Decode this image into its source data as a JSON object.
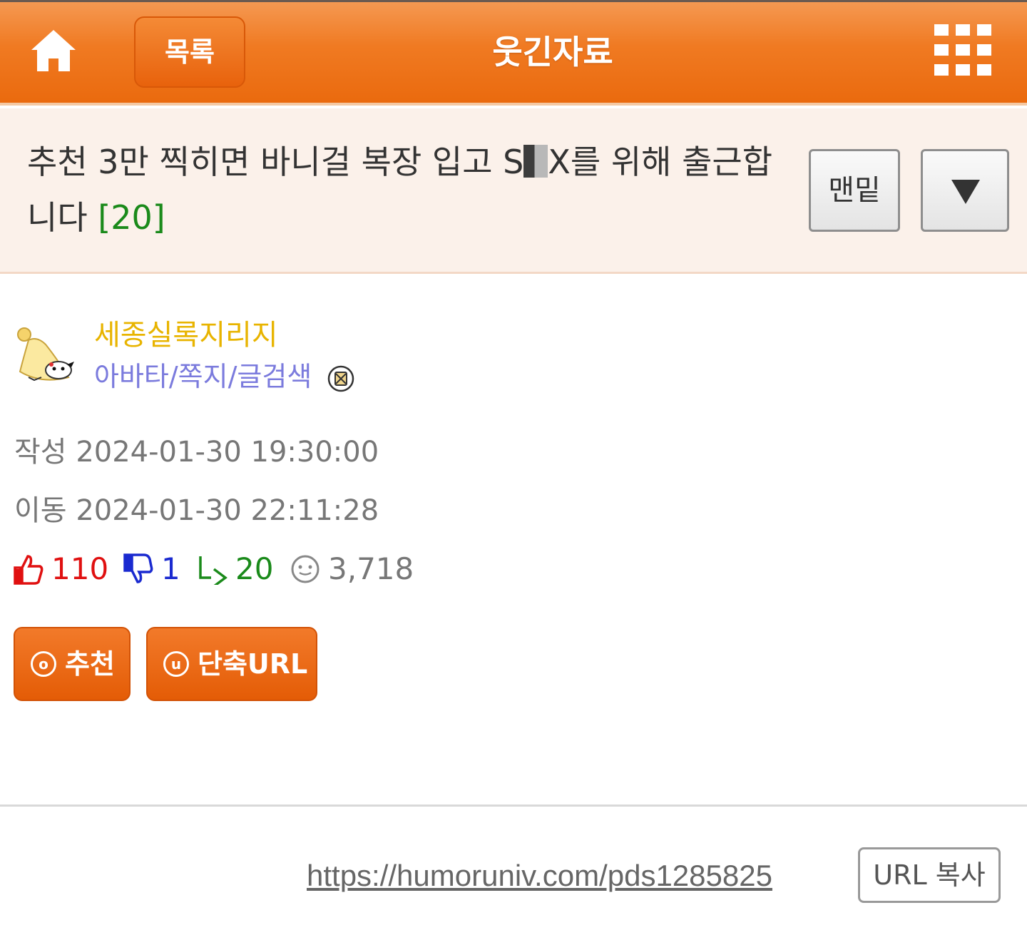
{
  "header": {
    "home_icon": "home-icon",
    "list_label": "목록",
    "board_title": "웃긴자료",
    "menu_icon": "grid-menu-icon"
  },
  "post": {
    "title_part1": "추천 3만 찍히면 바니걸 복장 입고 S",
    "title_part2": "X를 위해 출근합니다",
    "comment_count": "[20]",
    "bottom_label": "맨밑"
  },
  "author": {
    "name": "세종실록지리지",
    "links": "아바타/쪽지/글검색"
  },
  "meta": {
    "written": "작성 2024-01-30 19:30:00",
    "moved": "이동 2024-01-30 22:11:28"
  },
  "stats": {
    "upvotes": "110",
    "downvotes": "1",
    "comments": "20",
    "views": "3,718"
  },
  "actions": {
    "recommend_label": "추천",
    "recommend_icon_char": "o",
    "shorturl_label": "단축URL",
    "shorturl_icon_char": "u"
  },
  "footer": {
    "url": "https://humoruniv.com/pds1285825",
    "copy_label": "URL 복사"
  },
  "colors": {
    "header_orange": "#f07a22",
    "title_bg": "#fbf1ea",
    "author_name": "#e8b400",
    "author_links": "#7b7bdd",
    "upvote": "#e01010",
    "downvote": "#1a2ad0",
    "comment": "#1a8a1a",
    "views": "#777777"
  }
}
